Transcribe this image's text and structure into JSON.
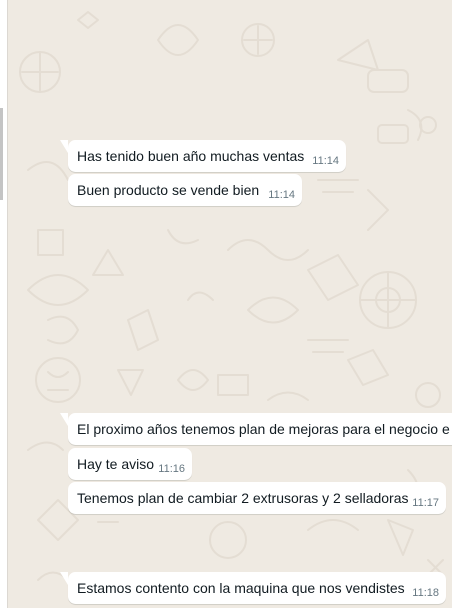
{
  "messages": [
    {
      "text": "Has tenido buen año muchas ventas",
      "time": "11:14"
    },
    {
      "text": "Buen producto se vende bien",
      "time": "11:14"
    },
    {
      "text": "El proximo años tenemos plan de mejoras para el negocio e",
      "time": ""
    },
    {
      "text": "Hay te aviso",
      "time": "11:16"
    },
    {
      "text": "Tenemos plan de cambiar 2 extrusoras y 2 selladoras",
      "time": "11:17"
    },
    {
      "text": "Estamos contento con la maquina que nos vendistes",
      "time": "11:18"
    }
  ],
  "colors": {
    "chat_background": "#efeae2",
    "bubble_incoming": "#ffffff",
    "message_text": "#111b21",
    "timestamp": "#667781"
  }
}
